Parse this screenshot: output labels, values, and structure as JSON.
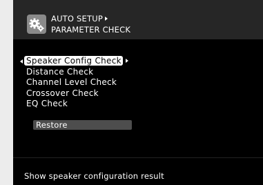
{
  "header": {
    "line1": "AUTO SETUP",
    "line2": "PARAMETER CHECK",
    "icon": "gear-icon"
  },
  "menu": {
    "items": [
      {
        "label": "Speaker Config Check",
        "selected": true
      },
      {
        "label": "Distance Check",
        "selected": false
      },
      {
        "label": "Channel Level Check",
        "selected": false
      },
      {
        "label": "Crossover Check",
        "selected": false
      },
      {
        "label": "EQ Check",
        "selected": false
      }
    ],
    "restore_label": "Restore"
  },
  "status": {
    "text": "Show speaker configuration result"
  },
  "colors": {
    "background": "#000000",
    "header": "#262626",
    "highlight": "#ffffff",
    "restore_bg": "#4d4d4d"
  }
}
